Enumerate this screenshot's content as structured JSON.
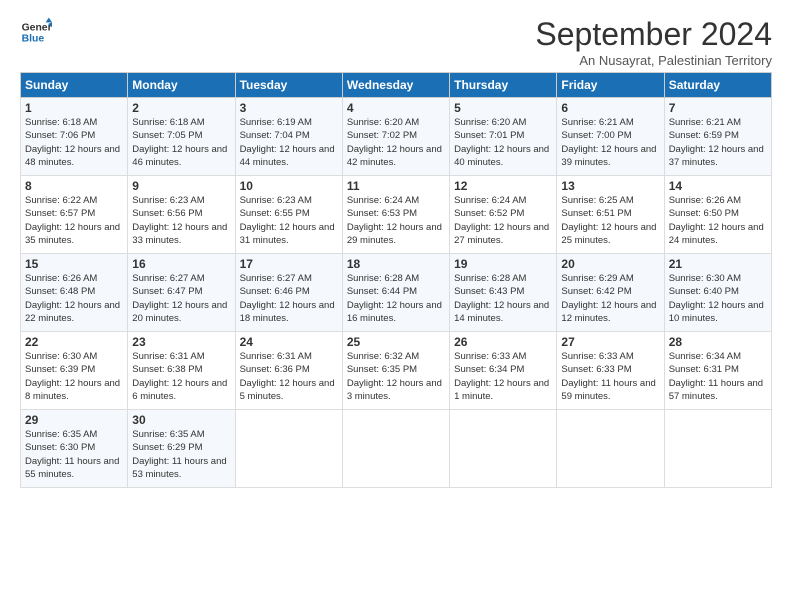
{
  "logo": {
    "line1": "General",
    "line2": "Blue"
  },
  "title": "September 2024",
  "subtitle": "An Nusayrat, Palestinian Territory",
  "days_of_week": [
    "Sunday",
    "Monday",
    "Tuesday",
    "Wednesday",
    "Thursday",
    "Friday",
    "Saturday"
  ],
  "weeks": [
    [
      {
        "day": "1",
        "sunrise": "Sunrise: 6:18 AM",
        "sunset": "Sunset: 7:06 PM",
        "daylight": "Daylight: 12 hours and 48 minutes."
      },
      {
        "day": "2",
        "sunrise": "Sunrise: 6:18 AM",
        "sunset": "Sunset: 7:05 PM",
        "daylight": "Daylight: 12 hours and 46 minutes."
      },
      {
        "day": "3",
        "sunrise": "Sunrise: 6:19 AM",
        "sunset": "Sunset: 7:04 PM",
        "daylight": "Daylight: 12 hours and 44 minutes."
      },
      {
        "day": "4",
        "sunrise": "Sunrise: 6:20 AM",
        "sunset": "Sunset: 7:02 PM",
        "daylight": "Daylight: 12 hours and 42 minutes."
      },
      {
        "day": "5",
        "sunrise": "Sunrise: 6:20 AM",
        "sunset": "Sunset: 7:01 PM",
        "daylight": "Daylight: 12 hours and 40 minutes."
      },
      {
        "day": "6",
        "sunrise": "Sunrise: 6:21 AM",
        "sunset": "Sunset: 7:00 PM",
        "daylight": "Daylight: 12 hours and 39 minutes."
      },
      {
        "day": "7",
        "sunrise": "Sunrise: 6:21 AM",
        "sunset": "Sunset: 6:59 PM",
        "daylight": "Daylight: 12 hours and 37 minutes."
      }
    ],
    [
      {
        "day": "8",
        "sunrise": "Sunrise: 6:22 AM",
        "sunset": "Sunset: 6:57 PM",
        "daylight": "Daylight: 12 hours and 35 minutes."
      },
      {
        "day": "9",
        "sunrise": "Sunrise: 6:23 AM",
        "sunset": "Sunset: 6:56 PM",
        "daylight": "Daylight: 12 hours and 33 minutes."
      },
      {
        "day": "10",
        "sunrise": "Sunrise: 6:23 AM",
        "sunset": "Sunset: 6:55 PM",
        "daylight": "Daylight: 12 hours and 31 minutes."
      },
      {
        "day": "11",
        "sunrise": "Sunrise: 6:24 AM",
        "sunset": "Sunset: 6:53 PM",
        "daylight": "Daylight: 12 hours and 29 minutes."
      },
      {
        "day": "12",
        "sunrise": "Sunrise: 6:24 AM",
        "sunset": "Sunset: 6:52 PM",
        "daylight": "Daylight: 12 hours and 27 minutes."
      },
      {
        "day": "13",
        "sunrise": "Sunrise: 6:25 AM",
        "sunset": "Sunset: 6:51 PM",
        "daylight": "Daylight: 12 hours and 25 minutes."
      },
      {
        "day": "14",
        "sunrise": "Sunrise: 6:26 AM",
        "sunset": "Sunset: 6:50 PM",
        "daylight": "Daylight: 12 hours and 24 minutes."
      }
    ],
    [
      {
        "day": "15",
        "sunrise": "Sunrise: 6:26 AM",
        "sunset": "Sunset: 6:48 PM",
        "daylight": "Daylight: 12 hours and 22 minutes."
      },
      {
        "day": "16",
        "sunrise": "Sunrise: 6:27 AM",
        "sunset": "Sunset: 6:47 PM",
        "daylight": "Daylight: 12 hours and 20 minutes."
      },
      {
        "day": "17",
        "sunrise": "Sunrise: 6:27 AM",
        "sunset": "Sunset: 6:46 PM",
        "daylight": "Daylight: 12 hours and 18 minutes."
      },
      {
        "day": "18",
        "sunrise": "Sunrise: 6:28 AM",
        "sunset": "Sunset: 6:44 PM",
        "daylight": "Daylight: 12 hours and 16 minutes."
      },
      {
        "day": "19",
        "sunrise": "Sunrise: 6:28 AM",
        "sunset": "Sunset: 6:43 PM",
        "daylight": "Daylight: 12 hours and 14 minutes."
      },
      {
        "day": "20",
        "sunrise": "Sunrise: 6:29 AM",
        "sunset": "Sunset: 6:42 PM",
        "daylight": "Daylight: 12 hours and 12 minutes."
      },
      {
        "day": "21",
        "sunrise": "Sunrise: 6:30 AM",
        "sunset": "Sunset: 6:40 PM",
        "daylight": "Daylight: 12 hours and 10 minutes."
      }
    ],
    [
      {
        "day": "22",
        "sunrise": "Sunrise: 6:30 AM",
        "sunset": "Sunset: 6:39 PM",
        "daylight": "Daylight: 12 hours and 8 minutes."
      },
      {
        "day": "23",
        "sunrise": "Sunrise: 6:31 AM",
        "sunset": "Sunset: 6:38 PM",
        "daylight": "Daylight: 12 hours and 6 minutes."
      },
      {
        "day": "24",
        "sunrise": "Sunrise: 6:31 AM",
        "sunset": "Sunset: 6:36 PM",
        "daylight": "Daylight: 12 hours and 5 minutes."
      },
      {
        "day": "25",
        "sunrise": "Sunrise: 6:32 AM",
        "sunset": "Sunset: 6:35 PM",
        "daylight": "Daylight: 12 hours and 3 minutes."
      },
      {
        "day": "26",
        "sunrise": "Sunrise: 6:33 AM",
        "sunset": "Sunset: 6:34 PM",
        "daylight": "Daylight: 12 hours and 1 minute."
      },
      {
        "day": "27",
        "sunrise": "Sunrise: 6:33 AM",
        "sunset": "Sunset: 6:33 PM",
        "daylight": "Daylight: 11 hours and 59 minutes."
      },
      {
        "day": "28",
        "sunrise": "Sunrise: 6:34 AM",
        "sunset": "Sunset: 6:31 PM",
        "daylight": "Daylight: 11 hours and 57 minutes."
      }
    ],
    [
      {
        "day": "29",
        "sunrise": "Sunrise: 6:35 AM",
        "sunset": "Sunset: 6:30 PM",
        "daylight": "Daylight: 11 hours and 55 minutes."
      },
      {
        "day": "30",
        "sunrise": "Sunrise: 6:35 AM",
        "sunset": "Sunset: 6:29 PM",
        "daylight": "Daylight: 11 hours and 53 minutes."
      },
      null,
      null,
      null,
      null,
      null
    ]
  ]
}
